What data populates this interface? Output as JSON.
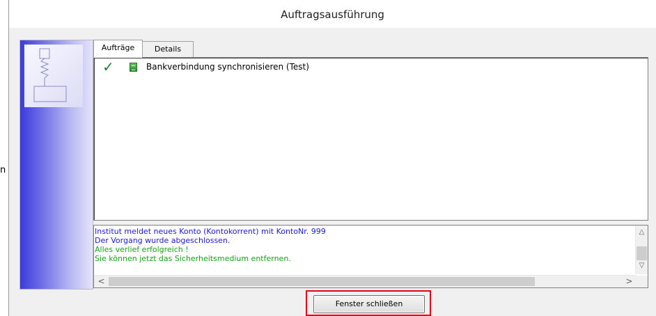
{
  "background": {
    "partial_text": "n"
  },
  "window": {
    "title": "Auftragsausführung"
  },
  "tabs": [
    {
      "label": "Aufträge",
      "active": true
    },
    {
      "label": "Details",
      "active": false
    }
  ],
  "jobs": [
    {
      "status": "success",
      "status_icon": "checkmark-icon",
      "type_icon": "document-icon",
      "label": "Bankverbindung synchronisieren (Test)"
    }
  ],
  "log": {
    "lines": [
      {
        "text": "Institut meldet neues Konto (Kontokorrent) mit KontoNr. 999",
        "color": "#1a1ad6"
      },
      {
        "text": "Der Vorgang wurde abgeschlossen.",
        "color": "#1a1ad6"
      },
      {
        "text": "Alles verlief erfolgreich !",
        "color": "#17a317"
      },
      {
        "text": "Sie können jetzt das Sicherheitsmedium entfernen.",
        "color": "#17a317"
      }
    ]
  },
  "buttons": {
    "close_label": "Fenster schließen"
  },
  "colors": {
    "highlight": "#e3001b",
    "side_gradient_start": "#3b3bdc"
  }
}
